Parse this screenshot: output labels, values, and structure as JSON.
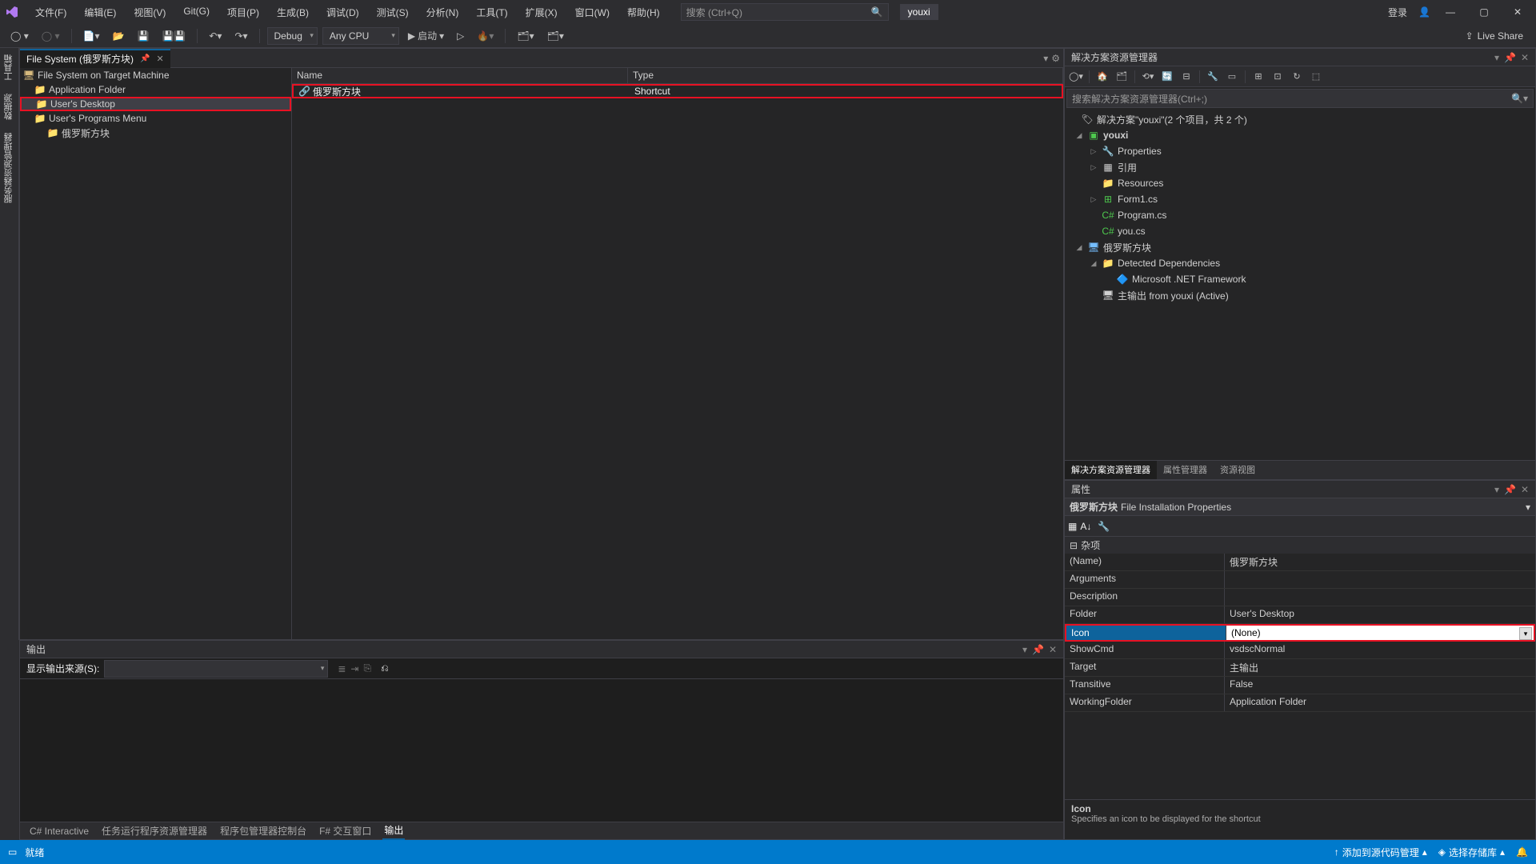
{
  "menu": [
    "文件(F)",
    "编辑(E)",
    "视图(V)",
    "Git(G)",
    "项目(P)",
    "生成(B)",
    "调试(D)",
    "测试(S)",
    "分析(N)",
    "工具(T)",
    "扩展(X)",
    "窗口(W)",
    "帮助(H)"
  ],
  "search_placeholder": "搜索 (Ctrl+Q)",
  "app_name": "youxi",
  "login": "登录",
  "toolbar": {
    "config": "Debug",
    "platform": "Any CPU",
    "start": "启动"
  },
  "liveshare": "Live Share",
  "vtabs": [
    "工具箱",
    "数据源",
    "服务器资源管理器"
  ],
  "doc": {
    "tab_title": "File System (俄罗斯方块)",
    "tree_root": "File System on Target Machine",
    "tree": [
      "Application Folder",
      "User's Desktop",
      "User's Programs Menu",
      "俄罗斯方块"
    ],
    "headers": {
      "name": "Name",
      "type": "Type"
    },
    "row": {
      "name": "俄罗斯方块",
      "type": "Shortcut"
    }
  },
  "output": {
    "title": "输出",
    "fromlabel": "显示输出来源(S):"
  },
  "bottom_tabs": [
    "C# Interactive",
    "任务运行程序资源管理器",
    "程序包管理器控制台",
    "F# 交互窗口",
    "输出"
  ],
  "solexp": {
    "title": "解决方案资源管理器",
    "search_placeholder": "搜索解决方案资源管理器(Ctrl+;)",
    "solution": "解决方案\"youxi\"(2 个项目，共 2 个)",
    "nodes": {
      "p1": "youxi",
      "p1_props": "Properties",
      "p1_refs": "引用",
      "p1_res": "Resources",
      "p1_form": "Form1.cs",
      "p1_prog": "Program.cs",
      "p1_you": "you.cs",
      "p2": "俄罗斯方块",
      "p2_dep": "Detected Dependencies",
      "p2_net": "Microsoft .NET Framework",
      "p2_out": "主输出 from youxi (Active)"
    },
    "tabs": [
      "解决方案资源管理器",
      "属性管理器",
      "资源视图"
    ]
  },
  "props": {
    "title": "属性",
    "obj_name": "俄罗斯方块",
    "obj_type": "File Installation Properties",
    "cat": "杂项",
    "rows": [
      {
        "n": "(Name)",
        "v": "俄罗斯方块"
      },
      {
        "n": "Arguments",
        "v": ""
      },
      {
        "n": "Description",
        "v": ""
      },
      {
        "n": "Folder",
        "v": "User's Desktop"
      },
      {
        "n": "Icon",
        "v": "(None)"
      },
      {
        "n": "ShowCmd",
        "v": "vsdscNormal"
      },
      {
        "n": "Target",
        "v": "主输出"
      },
      {
        "n": "Transitive",
        "v": "False"
      },
      {
        "n": "WorkingFolder",
        "v": "Application Folder"
      }
    ],
    "help_name": "Icon",
    "help_desc": "Specifies an icon to be displayed for the shortcut"
  },
  "status": {
    "ready": "就绪",
    "addsrc": "添加到源代码管理",
    "selectrepo": "选择存储库"
  }
}
